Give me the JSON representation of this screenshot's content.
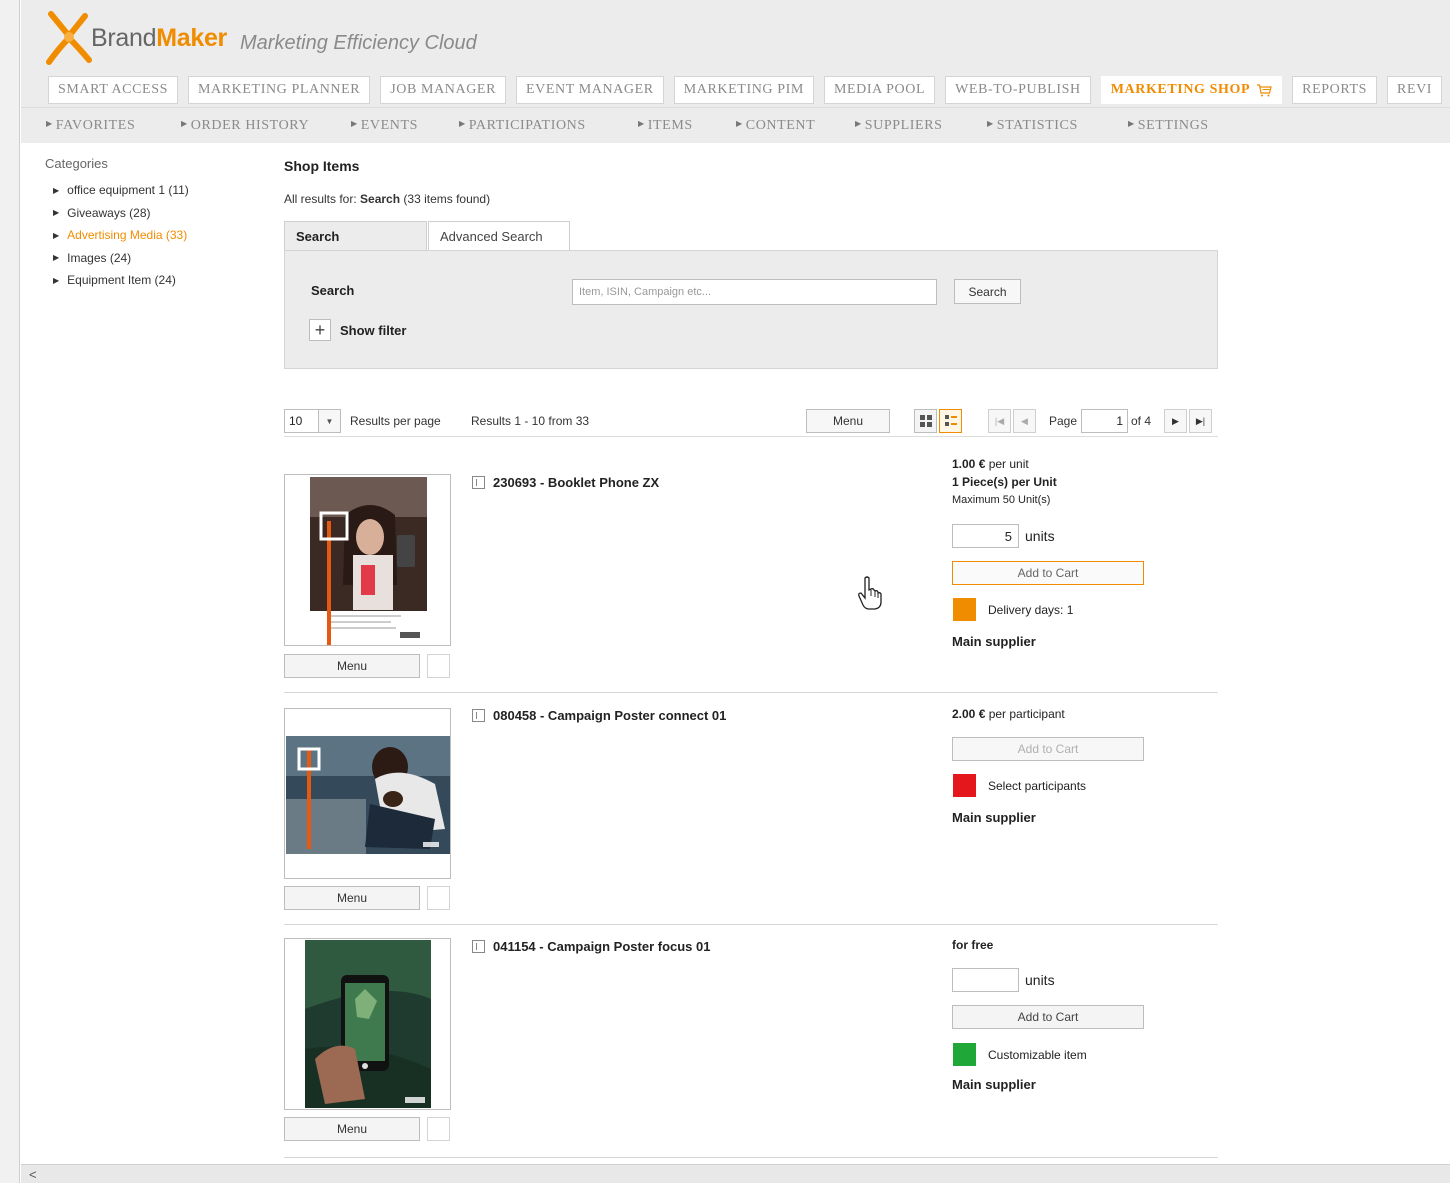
{
  "app": {
    "brand_light": "Brand",
    "brand_bold": "Maker",
    "tagline": "Marketing Efficiency Cloud",
    "accent_color": "#f08c00"
  },
  "main_nav": [
    {
      "label": "SMART ACCESS",
      "active": false
    },
    {
      "label": "MARKETING PLANNER",
      "active": false
    },
    {
      "label": "JOB MANAGER",
      "active": false
    },
    {
      "label": "EVENT MANAGER",
      "active": false
    },
    {
      "label": "MARKETING PIM",
      "active": false
    },
    {
      "label": "MEDIA POOL",
      "active": false
    },
    {
      "label": "WEB-TO-PUBLISH",
      "active": false
    },
    {
      "label": "MARKETING SHOP",
      "active": true,
      "icon": "cart-icon"
    },
    {
      "label": "REPORTS",
      "active": false
    },
    {
      "label": "REVI",
      "active": false
    }
  ],
  "sub_nav": [
    "FAVORITES",
    "ORDER HISTORY",
    "EVENTS",
    "PARTICIPATIONS",
    "ITEMS",
    "CONTENT",
    "SUPPLIERS",
    "STATISTICS",
    "SETTINGS"
  ],
  "sidebar": {
    "title": "Categories",
    "items": [
      {
        "label": "office equipment 1 (11)",
        "active": false
      },
      {
        "label": "Giveaways (28)",
        "active": false
      },
      {
        "label": "Advertising Media (33)",
        "active": true
      },
      {
        "label": "Images (24)",
        "active": false
      },
      {
        "label": "Equipment Item (24)",
        "active": false
      }
    ]
  },
  "main": {
    "title": "Shop Items",
    "results_prefix": "All results for: ",
    "results_query": "Search",
    "results_suffix": " (33 items found)",
    "tabs": [
      "Search",
      "Advanced Search"
    ],
    "search": {
      "label": "Search",
      "placeholder": "Item, ISIN, Campaign etc...",
      "button": "Search",
      "show_filter": "Show filter"
    }
  },
  "toolbar": {
    "per_page_value": "10",
    "per_page_label": "Results per page",
    "results_summary": "Results 1 - 10 from 33",
    "menu_label": "Menu",
    "page_label": "Page",
    "page_value": "1",
    "page_total": "of 4"
  },
  "items": [
    {
      "title": "230693 - Booklet Phone ZX",
      "price_bold": "1.00 €",
      "price_rest": " per unit",
      "pieces": "1 Piece(s) per Unit",
      "maximum": "Maximum 50 Unit(s)",
      "quantity": "5",
      "units_label": "units",
      "cart_label": "Add to Cart",
      "status_color": "#f08c00",
      "status_text": "Delivery days: 1",
      "supplier": "Main supplier",
      "menu_label": "Menu"
    },
    {
      "title": "080458 - Campaign Poster connect 01",
      "price_bold": "2.00 €",
      "price_rest": " per participant",
      "cart_label": "Add to Cart",
      "status_color": "#e3171c",
      "status_text": "Select participants",
      "supplier": "Main supplier",
      "menu_label": "Menu"
    },
    {
      "title": "041154 - Campaign Poster focus 01",
      "price_free": "for free",
      "quantity": "",
      "units_label": "units",
      "cart_label": "Add to Cart",
      "status_color": "#1fa838",
      "status_text": "Customizable item",
      "supplier": "Main supplier",
      "menu_label": "Menu"
    }
  ]
}
